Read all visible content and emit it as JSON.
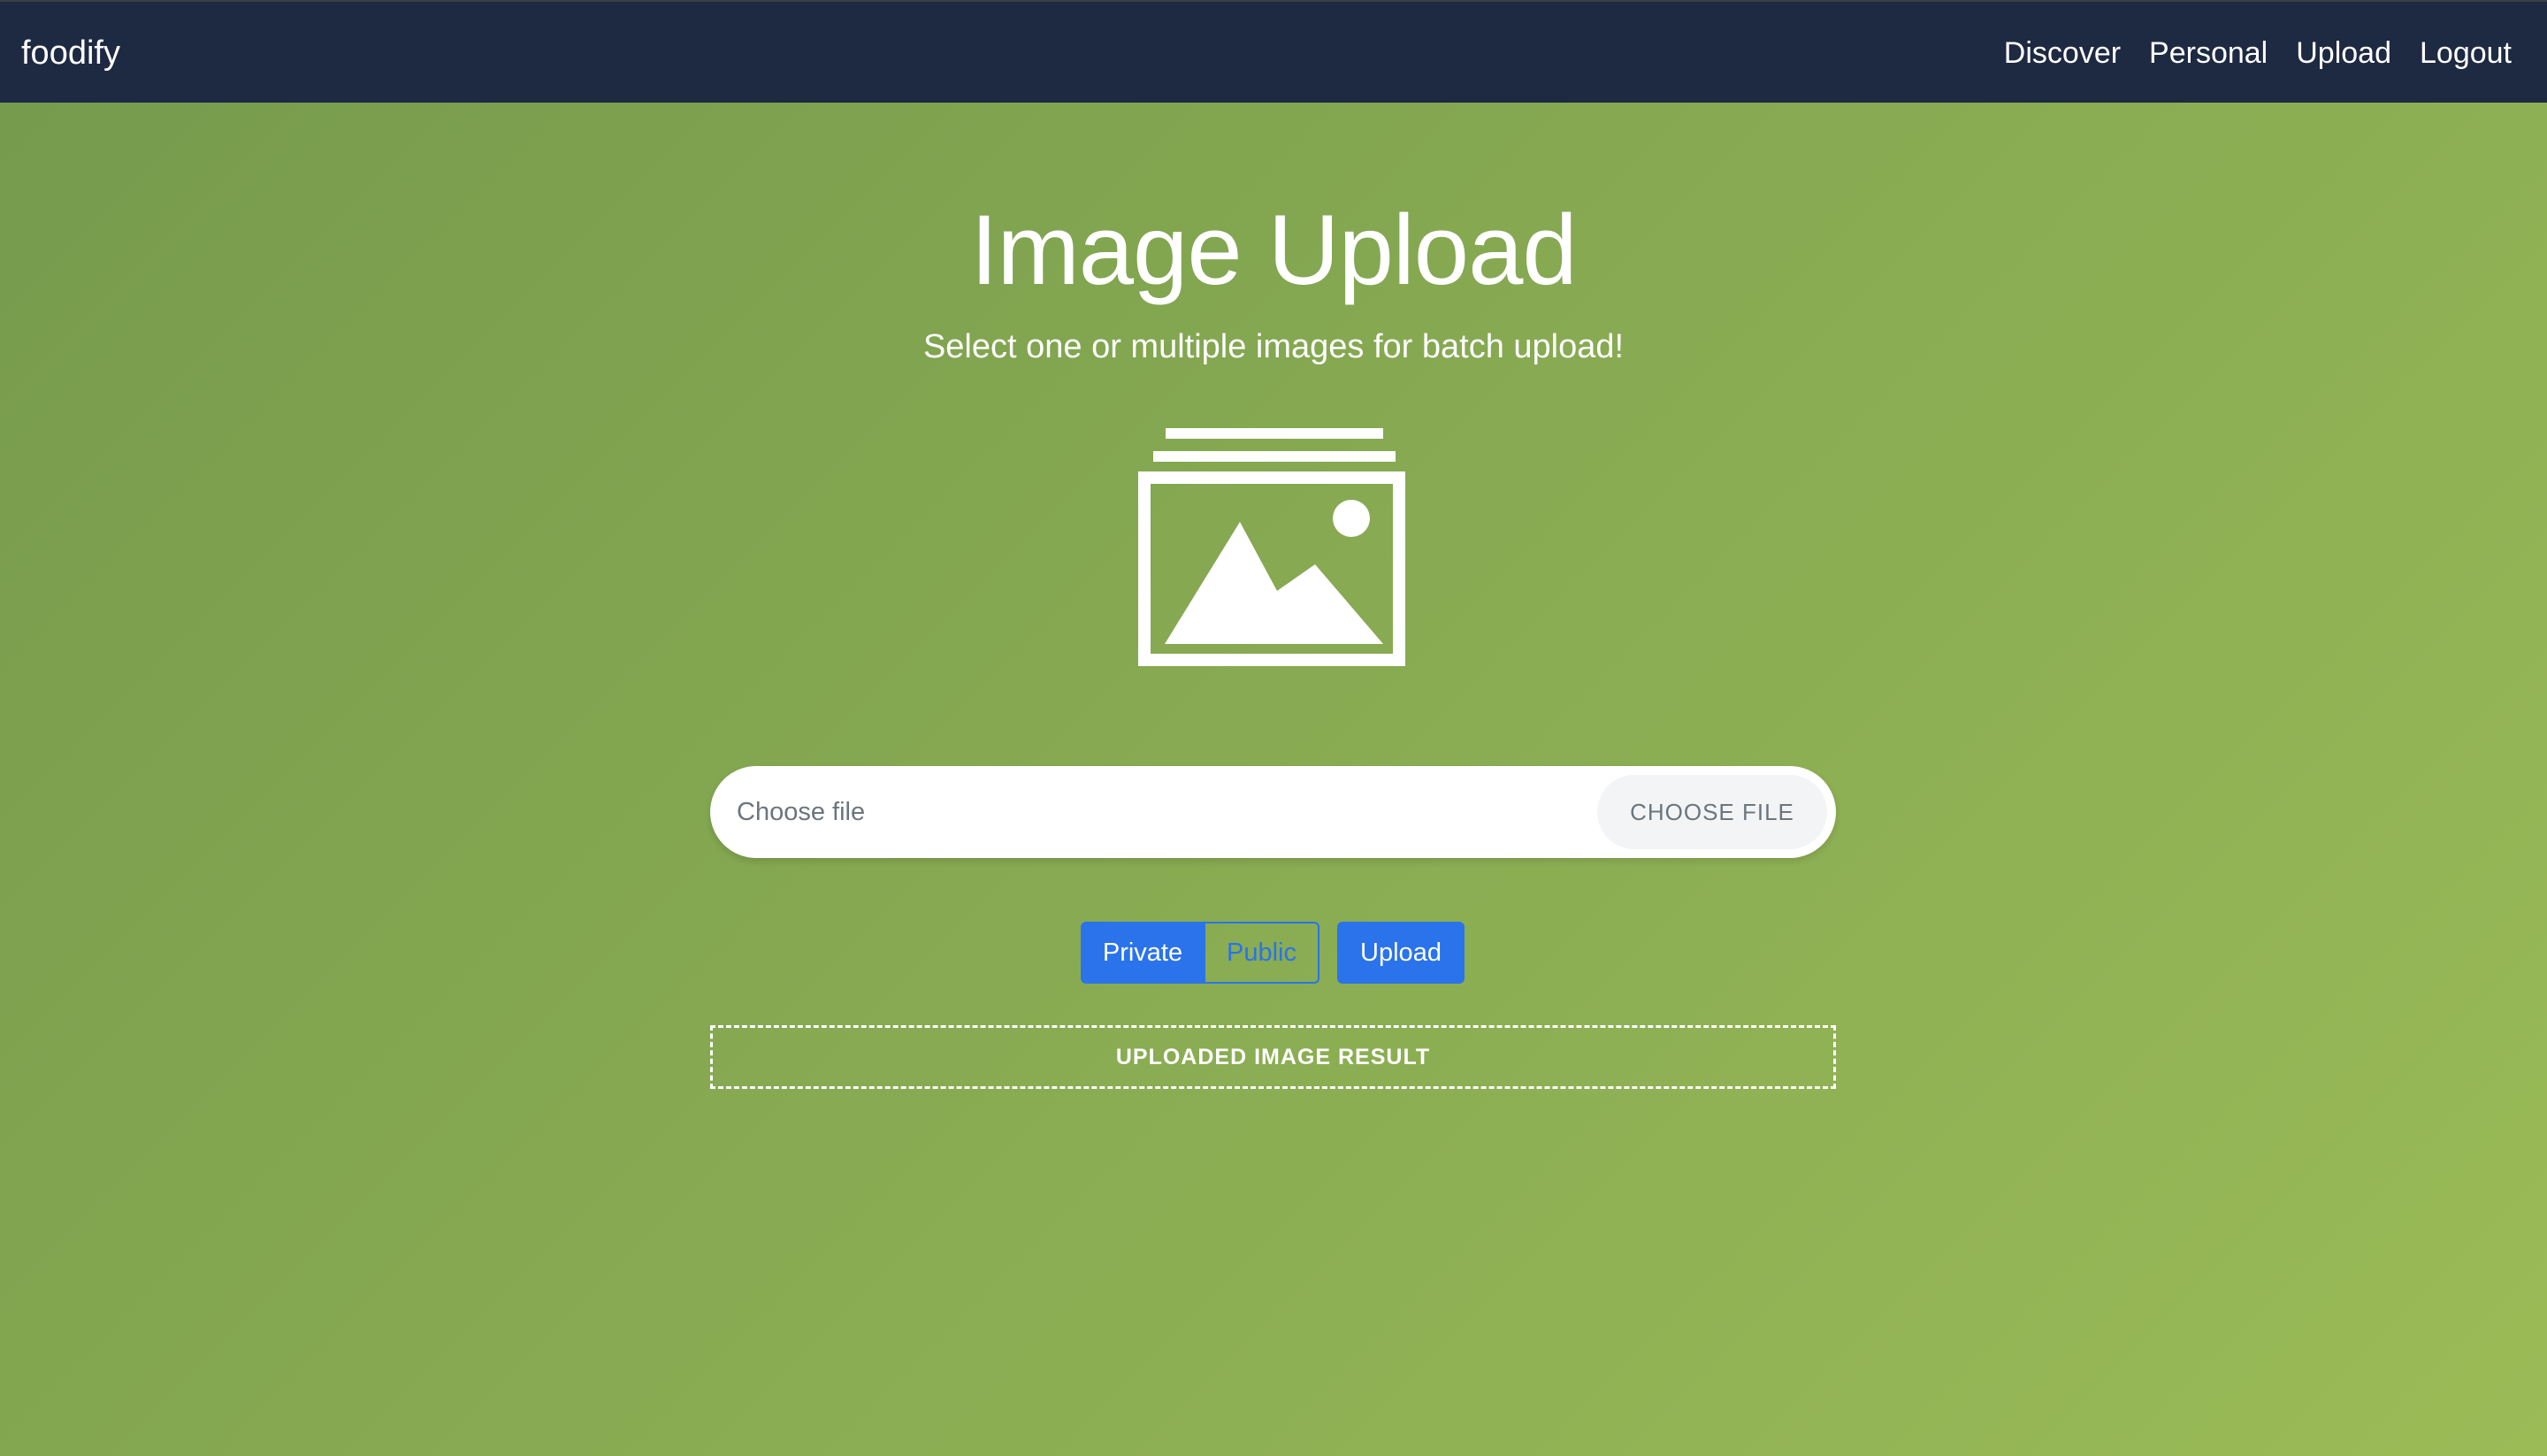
{
  "navbar": {
    "brand": "foodify",
    "links": [
      "Discover",
      "Personal",
      "Upload",
      "Logout"
    ]
  },
  "main": {
    "title": "Image Upload",
    "subtitle": "Select one or multiple images for batch upload!",
    "icon": "image-stack-icon",
    "file_input": {
      "placeholder": "Choose file",
      "button_label": "CHOOSE FILE"
    },
    "visibility": {
      "private_label": "Private",
      "public_label": "Public",
      "selected": "Private"
    },
    "upload_label": "Upload",
    "result_label": "UPLOADED IMAGE RESULT"
  },
  "colors": {
    "navbar": "#1e2942",
    "primary": "#2a73eb",
    "background_start": "#759a4c",
    "background_end": "#9bbb57"
  }
}
